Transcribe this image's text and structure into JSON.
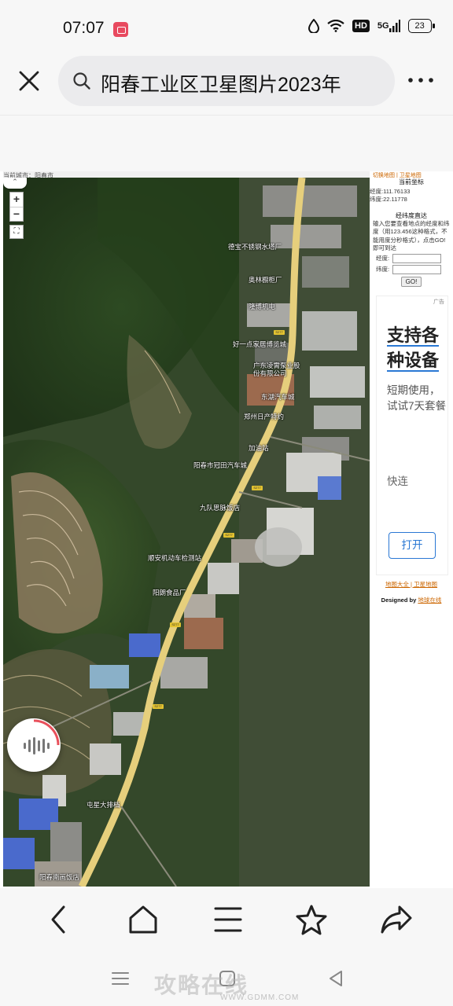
{
  "status": {
    "time": "07:07",
    "hd_label": "HD",
    "network_label": "5G",
    "battery": "23"
  },
  "browser": {
    "search_text": "阳春工业区卫星图片2023年",
    "toolbar": [
      "back-icon",
      "home-icon",
      "menu-icon",
      "favorite-icon",
      "share-icon"
    ]
  },
  "map": {
    "caption": "当前城市：阳春市",
    "zoom_in": "+",
    "zoom_out": "−",
    "fullscreen": "⛶",
    "pois": [
      {
        "label": "德宝不锈钢水塔厂"
      },
      {
        "label": "奥林橱柜厂"
      },
      {
        "label": "隆博机电"
      },
      {
        "label": "好一点家居博览城"
      },
      {
        "label": "广东凌霄泵业股份有限公司"
      },
      {
        "label": "东湖汽车城"
      },
      {
        "label": "郑州日产特约"
      },
      {
        "label": "加油站"
      },
      {
        "label": "阳春市冠田汽车城"
      },
      {
        "label": "九队思脉饭店"
      },
      {
        "label": "顺安机动车检测站"
      },
      {
        "label": "阳朗食品厂"
      },
      {
        "label": "屯星大排档"
      },
      {
        "label": "阳春南画饭店"
      }
    ],
    "road_tags": [
      "S277",
      "S277",
      "S277",
      "S277",
      "S277"
    ]
  },
  "sidebar": {
    "coord_title": "当前坐标",
    "lng_label": "经度:111.76133",
    "lat_label": "纬度:22.11778",
    "goto_title": "经纬度直达",
    "goto_desc": "输入您要查看地点的经度和纬度（用123.456这种格式，不能用度分秒格式），点击GO!即可到达",
    "lng_input_label": "经度:",
    "lat_input_label": "纬度:",
    "go_label": "GO!",
    "top_links": "切换地图 | 卫星地图",
    "links": "地图大全 | 卫星地图",
    "designed_by_prefix": "Designed by",
    "designed_by_name": "地球在线"
  },
  "ad": {
    "label": "广告",
    "headline": "支持各种设备",
    "body": "短期使用，试试7天套餐",
    "sub": "快连",
    "button": "打开"
  },
  "watermark": {
    "text": "攻略在线",
    "url": "WWW.GDMM.COM"
  }
}
